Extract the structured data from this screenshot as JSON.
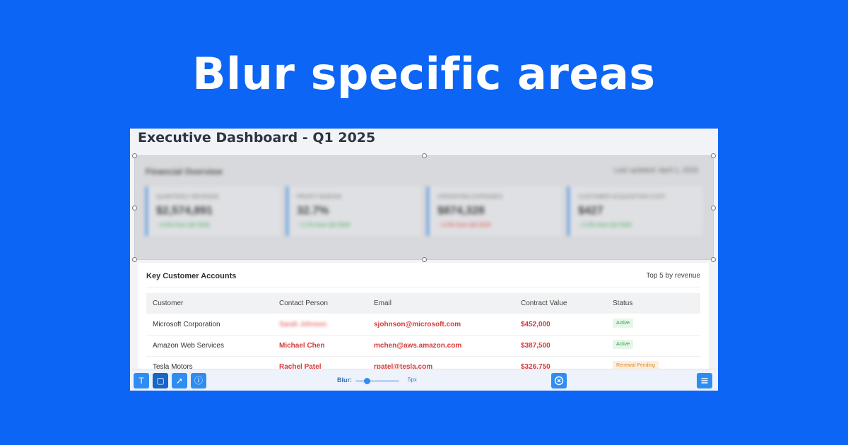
{
  "headline": "Blur specific areas",
  "dashboard": {
    "title": "Executive Dashboard - Q1 2025",
    "financial": {
      "heading": "Financial Overview",
      "updated": "Last updated: April 1, 2025",
      "metrics": [
        {
          "label": "Quarterly Revenue",
          "value": "$2,574,891",
          "trend": "↑ 8.4% from Q4 2024",
          "dir": "up"
        },
        {
          "label": "Profit Margin",
          "value": "32.7%",
          "trend": "↑ 2.1% from Q4 2024",
          "dir": "up"
        },
        {
          "label": "Operating Expenses",
          "value": "$874,328",
          "trend": "↑ 4.3% from Q4 2024",
          "dir": "down"
        },
        {
          "label": "Customer Acquisition Cost",
          "value": "$427",
          "trend": "↓ 6.2% from Q4 2024",
          "dir": "up"
        }
      ]
    },
    "accounts": {
      "title": "Key Customer Accounts",
      "subtitle": "Top 5 by revenue",
      "columns": [
        "Customer",
        "Contact Person",
        "Email",
        "Contract Value",
        "Status"
      ],
      "rows": [
        {
          "customer": "Microsoft Corporation",
          "contact": "Sarah Johnson",
          "email": "sjohnson@microsoft.com",
          "value": "$452,000",
          "status": "Active",
          "contact_blurred": true
        },
        {
          "customer": "Amazon Web Services",
          "contact": "Michael Chen",
          "email": "mchen@aws.amazon.com",
          "value": "$387,500",
          "status": "Active",
          "contact_blurred": false
        },
        {
          "customer": "Tesla Motors",
          "contact": "Rachel Patel",
          "email": "rpatel@tesla.com",
          "value": "$326,750",
          "status": "Renewal Pending",
          "contact_blurred": false
        }
      ]
    }
  },
  "toolbar": {
    "tools": [
      {
        "name": "text-tool",
        "icon": "text-icon",
        "glyph": "T"
      },
      {
        "name": "rectangle-tool",
        "icon": "rectangle-icon",
        "glyph": "▢"
      },
      {
        "name": "select-tool",
        "icon": "cursor-icon",
        "glyph": "➚"
      },
      {
        "name": "info-tool",
        "icon": "info-icon",
        "glyph": "ⓘ"
      }
    ],
    "blur_label": "Blur:",
    "blur_value": "5px",
    "blur_level": 0.25,
    "clear_icon": "cancel-icon",
    "menu_icon": "menu-icon"
  },
  "colors": {
    "background": "#0c65f5",
    "accent": "#2f8df1",
    "red_text": "#d63a3a",
    "active_badge": "#2e9e44",
    "pending_badge": "#e08a1d"
  }
}
